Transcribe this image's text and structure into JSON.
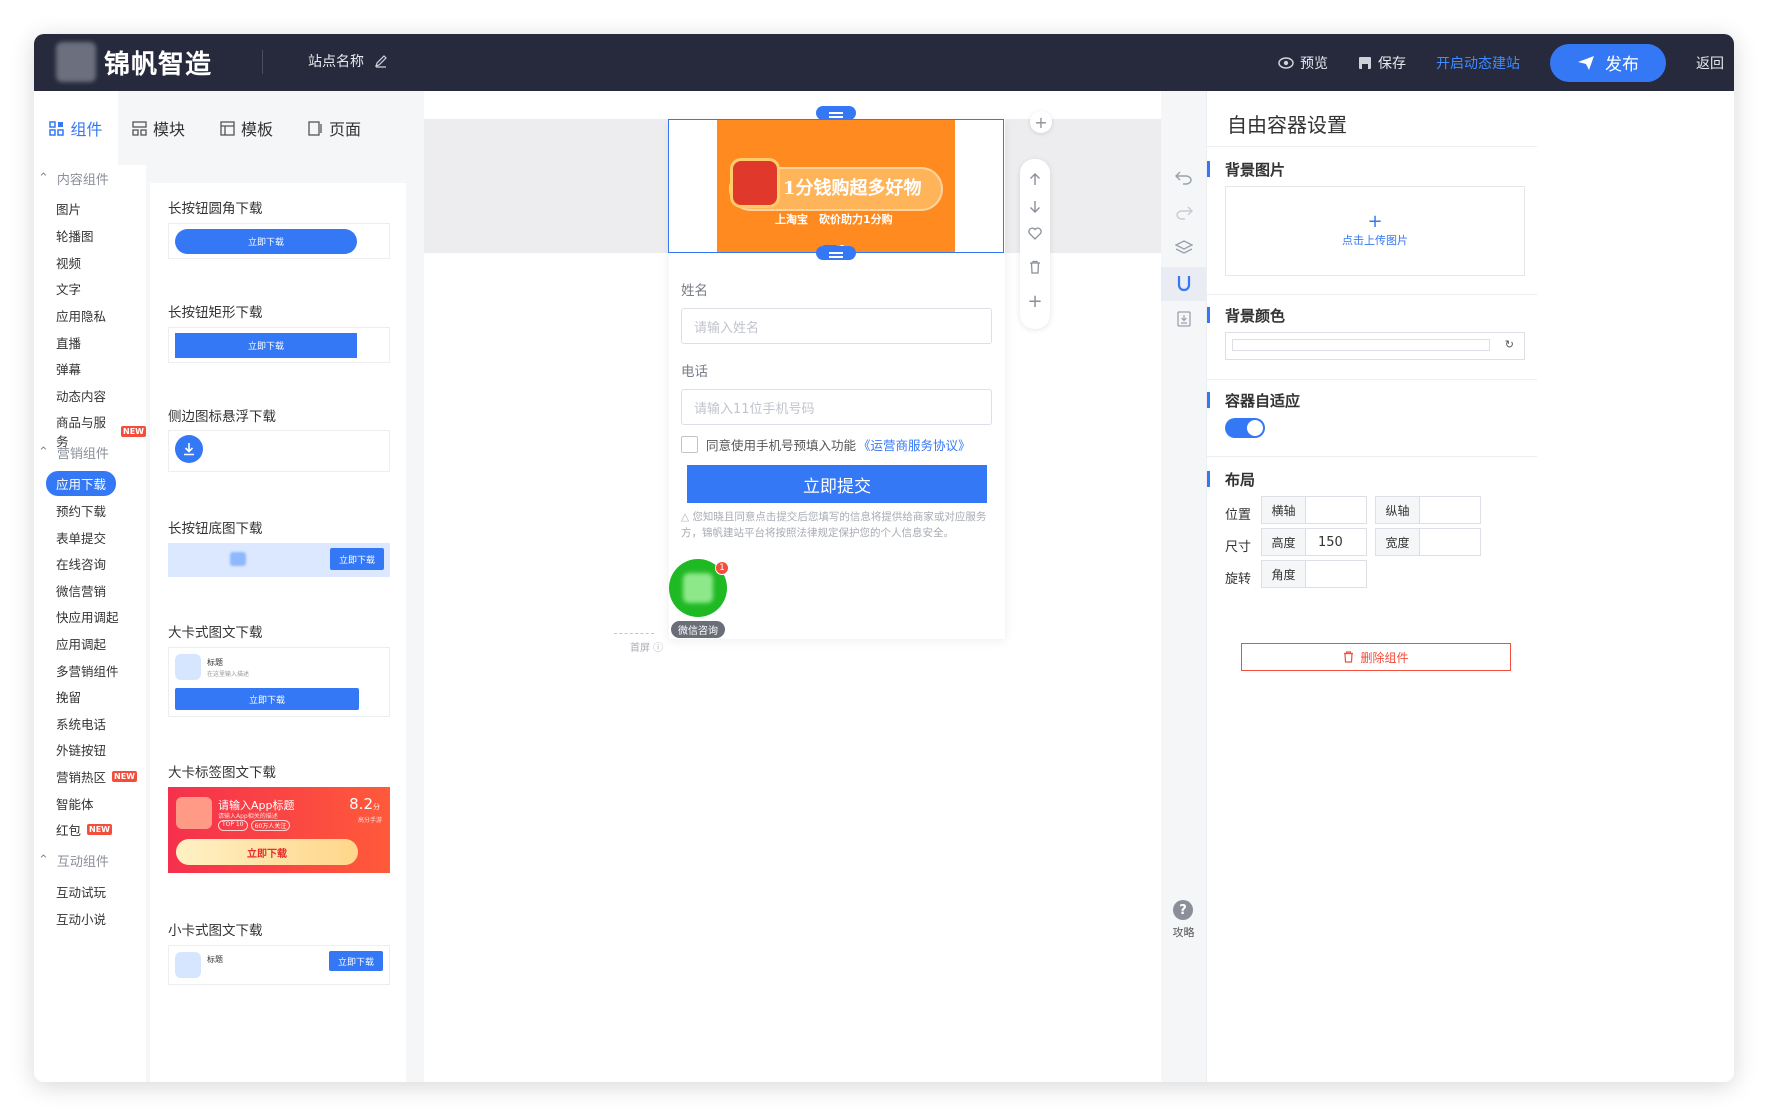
{
  "topbar": {
    "brand": "锦帆智造",
    "site_name": "站点名称",
    "preview": "预览",
    "save": "保存",
    "dynamic": "开启动态建站",
    "publish": "发布",
    "back": "返回"
  },
  "left_tabs": [
    "组件",
    "模块",
    "模板",
    "页面"
  ],
  "categories": {
    "content": "内容组件",
    "content_items": [
      "图片",
      "轮播图",
      "视频",
      "文字",
      "应用隐私",
      "直播",
      "弹幕",
      "动态内容",
      "商品与服务"
    ],
    "marketing": "营销组件",
    "marketing_items": [
      "应用下载",
      "预约下载",
      "表单提交",
      "在线咨询",
      "微信营销",
      "快应用调起",
      "应用调起",
      "多营销组件",
      "挽留",
      "系统电话",
      "外链按钮",
      "营销热区",
      "智能体",
      "红包"
    ],
    "interactive": "互动组件",
    "interactive_items": [
      "互动试玩",
      "互动小说"
    ],
    "new_badge": "NEW"
  },
  "cards": {
    "c1_title": "长按钮圆角下载",
    "c2_title": "长按钮矩形下载",
    "c3_title": "侧边图标悬浮下载",
    "c4_title": "长按钮底图下载",
    "c5_title": "大卡式图文下载",
    "c6_title": "大卡标签图文下载",
    "c7_title": "小卡式图文下载",
    "download": "立即下载",
    "small_title": "标题",
    "small_desc": "在这里输入描述",
    "app_title": "请输入App标题",
    "app_desc": "请输入App相关的描述",
    "tag1": "TOP 10",
    "tag2": "60万人关注",
    "score": "8.2",
    "score_unit": "分",
    "score_label": "高分手游"
  },
  "canvas": {
    "banner_title": "1分钱购超多好物",
    "banner_sub": "上淘宝　砍价助力1分购",
    "name_label": "姓名",
    "name_placeholder": "请输入姓名",
    "phone_label": "电话",
    "phone_placeholder": "请输入11位手机号码",
    "agree_text": "同意使用手机号预填入功能",
    "agree_link": "《运营商服务协议》",
    "submit": "立即提交",
    "disclaimer": "△ 您知晓且同意点击提交后您填写的信息将提供给商家或对应服务方，锦帆建站平台将按照法律规定保护您的个人信息安全。",
    "wechat": "微信咨询",
    "badge": "1",
    "first_screen": "首屏"
  },
  "strip": {
    "help": "攻略"
  },
  "panel": {
    "title": "自由容器设置",
    "bg_image": "背景图片",
    "upload": "点击上传图片",
    "bg_color": "背景颜色",
    "adaptive": "容器自适应",
    "layout": "布局",
    "pos_label": "位置",
    "pos_x": "横轴",
    "pos_y": "纵轴",
    "size_label": "尺寸",
    "height_k": "高度",
    "height_v": "150",
    "width_k": "宽度",
    "rot_label": "旋转",
    "angle_k": "角度",
    "delete": "删除组件"
  },
  "colors": {
    "accent": "#3478f6",
    "topbar": "#262a3c",
    "banner": "#ff8a1f",
    "danger": "#f34d3c"
  }
}
